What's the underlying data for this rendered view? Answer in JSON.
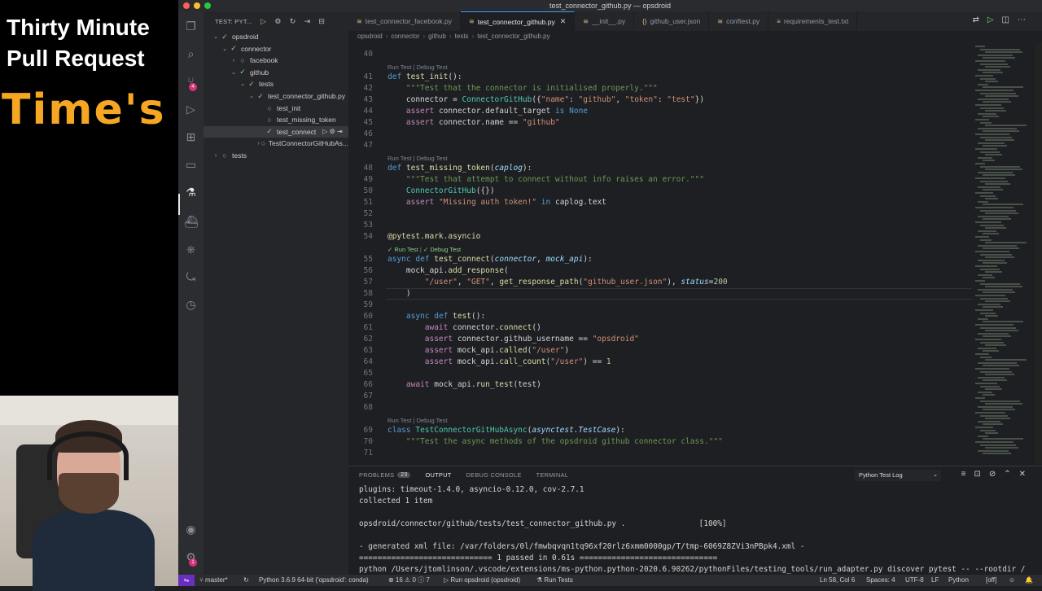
{
  "overlay": {
    "title_line1": "Thirty Minute",
    "title_line2": "Pull Request",
    "subtitle": "Time's"
  },
  "window": {
    "title": "test_connector_github.py — opsdroid"
  },
  "activity_bar": {
    "scm_badge": "4",
    "settings_badge": "1"
  },
  "sidebar": {
    "header": "TEST: PYT...",
    "tree": [
      {
        "label": "opsdroid",
        "depth": 0,
        "chevron": "⌄",
        "check": "✓"
      },
      {
        "label": "connector",
        "depth": 1,
        "chevron": "⌄",
        "check": "✓"
      },
      {
        "label": "facebook",
        "depth": 2,
        "chevron": "›",
        "check": "○"
      },
      {
        "label": "github",
        "depth": 2,
        "chevron": "⌄",
        "check": "✓"
      },
      {
        "label": "tests",
        "depth": 3,
        "chevron": "⌄",
        "check": "✓"
      },
      {
        "label": "test_connector_github.py",
        "depth": 4,
        "chevron": "⌄",
        "check": "✓"
      },
      {
        "label": "test_init",
        "depth": 5,
        "chevron": "",
        "check": "○"
      },
      {
        "label": "test_missing_token",
        "depth": 5,
        "chevron": "",
        "check": "○"
      },
      {
        "label": "test_connect",
        "depth": 5,
        "chevron": "",
        "check": "✓"
      },
      {
        "label": "TestConnectorGitHubAs...",
        "depth": 5,
        "chevron": "›",
        "check": "○"
      },
      {
        "label": "tests",
        "depth": 0,
        "chevron": "›",
        "check": "○"
      }
    ]
  },
  "tabs": [
    {
      "label": "test_connector_facebook.py",
      "icon": "≋"
    },
    {
      "label": "test_connector_github.py",
      "icon": "≋",
      "active": true
    },
    {
      "label": "__init__.py",
      "icon": "≋"
    },
    {
      "label": "github_user.json",
      "icon": "{}"
    },
    {
      "label": "conftest.py",
      "icon": "≋"
    },
    {
      "label": "requirements_test.txt",
      "icon": "≡"
    }
  ],
  "breadcrumb": [
    "opsdroid",
    "connector",
    "github",
    "tests",
    "test_connector_github.py"
  ],
  "editor": {
    "codelens": {
      "run": "Run Test",
      "sep": "|",
      "debug": "Debug Test"
    },
    "lines": [
      {
        "n": "40",
        "c": ""
      },
      {
        "n": "41",
        "c": "<span class='df'>def</span> <span class='fn'>test_init</span>():"
      },
      {
        "n": "42",
        "c": "    <span class='ds'>\"\"\"Test that the connector is initialised properly.\"\"\"</span>"
      },
      {
        "n": "43",
        "c": "    connector = <span class='cls'>ConnectorGitHub</span>({<span class='st'>\"name\"</span>: <span class='st'>\"github\"</span>, <span class='st'>\"token\"</span>: <span class='st'>\"test\"</span>})"
      },
      {
        "n": "44",
        "c": "    <span class='kw'>assert</span> connector.default_target <span class='df'>is</span> <span class='none'>None</span>"
      },
      {
        "n": "45",
        "c": "    <span class='kw'>assert</span> connector.name == <span class='st'>\"github\"</span>"
      },
      {
        "n": "46",
        "c": ""
      },
      {
        "n": "47",
        "c": ""
      },
      {
        "n": "48",
        "c": "<span class='df'>def</span> <span class='fn'>test_missing_token</span>(<span class='par'>caplog</span>):"
      },
      {
        "n": "49",
        "c": "    <span class='ds'>\"\"\"Test that attempt to connect without info raises an error.\"\"\"</span>"
      },
      {
        "n": "50",
        "c": "    <span class='cls'>ConnectorGitHub</span>({})"
      },
      {
        "n": "51",
        "c": "    <span class='kw'>assert</span> <span class='st'>\"Missing auth token!\"</span> <span class='df'>in</span> caplog.text"
      },
      {
        "n": "52",
        "c": ""
      },
      {
        "n": "53",
        "c": ""
      },
      {
        "n": "54",
        "c": "<span class='dec'>@pytest.mark.asyncio</span>"
      },
      {
        "n": "55",
        "c": "<span class='df'>async</span> <span class='df'>def</span> <span class='fn'>test_connect</span>(<span class='par'>connector</span>, <span class='par'>mock_api</span>):"
      },
      {
        "n": "56",
        "c": "    mock_api.<span class='fn'>add_response</span>("
      },
      {
        "n": "57",
        "c": "        <span class='st'>\"/user\"</span>, <span class='st'>\"GET\"</span>, <span class='fn'>get_response_path</span>(<span class='st'>\"github_user.json\"</span>), <span class='par'>status</span>=<span class='nm'>200</span>"
      },
      {
        "n": "58",
        "c": "    )"
      },
      {
        "n": "59",
        "c": ""
      },
      {
        "n": "60",
        "c": "    <span class='df'>async</span> <span class='df'>def</span> <span class='fn'>test</span>():"
      },
      {
        "n": "61",
        "c": "        <span class='kw'>await</span> connector.<span class='fn'>connect</span>()"
      },
      {
        "n": "62",
        "c": "        <span class='kw'>assert</span> connector.github_username == <span class='st'>\"opsdroid\"</span>"
      },
      {
        "n": "63",
        "c": "        <span class='kw'>assert</span> mock_api.<span class='fn'>called</span>(<span class='st'>\"/user\"</span>)"
      },
      {
        "n": "64",
        "c": "        <span class='kw'>assert</span> mock_api.<span class='fn'>call_count</span>(<span class='st'>\"/user\"</span>) == <span class='nm'>1</span>"
      },
      {
        "n": "65",
        "c": ""
      },
      {
        "n": "66",
        "c": "    <span class='kw'>await</span> mock_api.<span class='fn'>run_test</span>(test)"
      },
      {
        "n": "67",
        "c": ""
      },
      {
        "n": "68",
        "c": ""
      },
      {
        "n": "69",
        "c": "<span class='df'>class</span> <span class='cls'>TestConnectorGitHubAsync</span>(<span class='par'>asynctest.TestCase</span>):"
      },
      {
        "n": "70",
        "c": "    <span class='ds'>\"\"\"Test the async methods of the opsdroid github connector class.\"\"\"</span>"
      },
      {
        "n": "71",
        "c": ""
      }
    ]
  },
  "panel": {
    "tabs": [
      {
        "label": "PROBLEMS",
        "badge": "23"
      },
      {
        "label": "OUTPUT",
        "active": true
      },
      {
        "label": "DEBUG CONSOLE"
      },
      {
        "label": "TERMINAL"
      }
    ],
    "channel": "Python Test Log",
    "output": [
      "plugins: timeout-1.4.0, asyncio-0.12.0, cov-2.7.1",
      "collected 1 item",
      "",
      "opsdroid/connector/github/tests/test_connector_github.py .                [100%]",
      "",
      "- generated xml file: /var/folders/0l/fmwbqvqn1tq96xf20rlz6xmm0000gp/T/tmp-6069Z8ZVi3nPBpk4.xml -",
      "============================= 1 passed in 0.61s ==============================",
      "python /Users/jtomlinson/.vscode/extensions/ms-python.python-2020.6.90262/pythonFiles/testing_tools/run_adapter.py discover pytest -- --rootdir /"
    ]
  },
  "statusbar": {
    "branch": "master*",
    "interpreter": "Python 3.6.9 64-bit ('opsdroid': conda)",
    "problems": "⊗ 16 ⚠ 0 ⓘ 7",
    "run_config": "▷ Run opsdroid (opsdroid)",
    "run_tests": "Run Tests",
    "position": "Ln 58, Col 6",
    "spaces": "Spaces: 4",
    "encoding": "UTF-8",
    "eol": "LF",
    "language": "Python",
    "off": "[off]"
  }
}
